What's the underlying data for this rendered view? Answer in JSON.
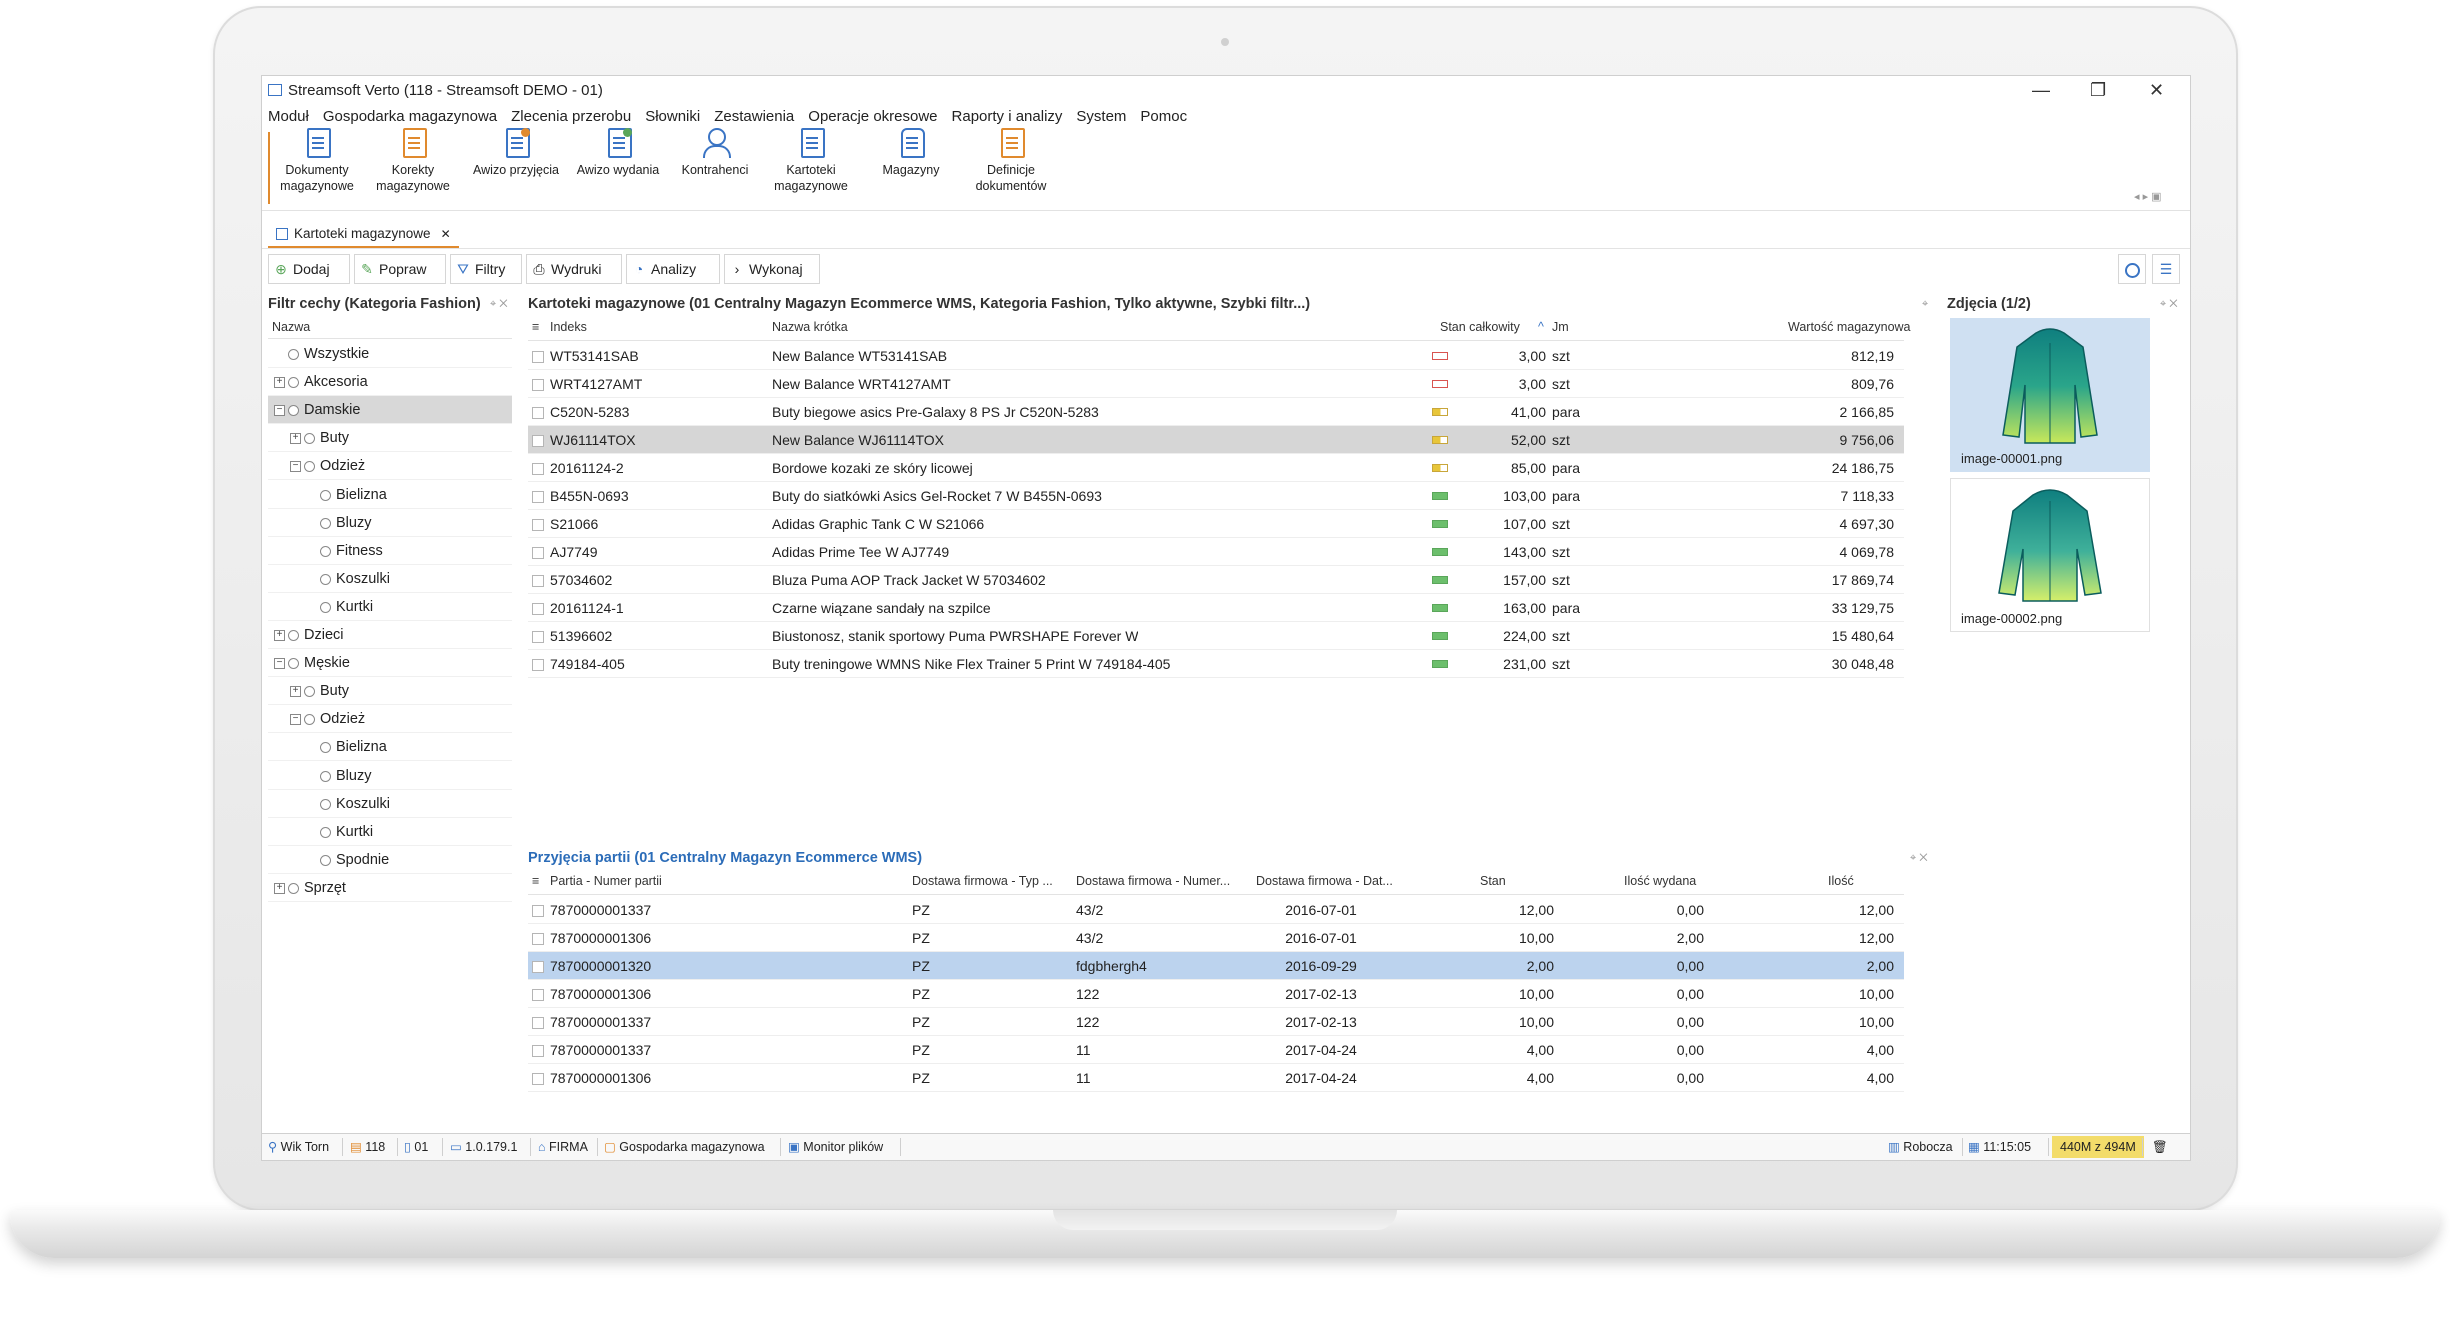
{
  "window": {
    "title": "Streamsoft Verto (118 - Streamsoft DEMO - 01)",
    "controls": [
      "—",
      "❐",
      "✕"
    ]
  },
  "menu": [
    "Moduł",
    "Gospodarka magazynowa",
    "Zlecenia przerobu",
    "Słowniki",
    "Zestawienia",
    "Operacje okresowe",
    "Raporty i analizy",
    "System",
    "Pomoc"
  ],
  "ribbon": [
    {
      "line1": "Dokumenty",
      "line2": "magazynowe"
    },
    {
      "line1": "Korekty",
      "line2": "magazynowe"
    },
    {
      "line1": "Awizo przyjęcia",
      "line2": ""
    },
    {
      "line1": "Awizo wydania",
      "line2": ""
    },
    {
      "line1": "Kontrahenci",
      "line2": ""
    },
    {
      "line1": "Kartoteki",
      "line2": "magazynowe"
    },
    {
      "line1": "Magazyny",
      "line2": ""
    },
    {
      "line1": "Definicje",
      "line2": "dokumentów"
    }
  ],
  "tab": {
    "label": "Kartoteki magazynowe",
    "close": "✕"
  },
  "toolbar": [
    {
      "icon": "⊕",
      "label": "Dodaj"
    },
    {
      "icon": "✎",
      "label": "Popraw"
    },
    {
      "icon": "⛛",
      "label": "Filtry"
    },
    {
      "icon": "⎙",
      "label": "Wydruki"
    },
    {
      "icon": "◔",
      "label": "Analizy"
    },
    {
      "icon": "›",
      "label": "Wykonaj"
    }
  ],
  "filter_panel": {
    "title": "Filtr cechy (Kategoria Fashion)",
    "column": "Nazwa",
    "items": [
      {
        "label": "Wszystkie",
        "level": 0,
        "expander": ""
      },
      {
        "label": "Akcesoria",
        "level": 0,
        "expander": "+"
      },
      {
        "label": "Damskie",
        "level": 0,
        "expander": "−",
        "selected": true
      },
      {
        "label": "Buty",
        "level": 1,
        "expander": "+"
      },
      {
        "label": "Odzież",
        "level": 1,
        "expander": "−"
      },
      {
        "label": "Bielizna",
        "level": 2,
        "expander": ""
      },
      {
        "label": "Bluzy",
        "level": 2,
        "expander": ""
      },
      {
        "label": "Fitness",
        "level": 2,
        "expander": ""
      },
      {
        "label": "Koszulki",
        "level": 2,
        "expander": ""
      },
      {
        "label": "Kurtki",
        "level": 2,
        "expander": ""
      },
      {
        "label": "Dzieci",
        "level": 0,
        "expander": "+"
      },
      {
        "label": "Męskie",
        "level": 0,
        "expander": "−"
      },
      {
        "label": "Buty",
        "level": 1,
        "expander": "+"
      },
      {
        "label": "Odzież",
        "level": 1,
        "expander": "−"
      },
      {
        "label": "Bielizna",
        "level": 2,
        "expander": ""
      },
      {
        "label": "Bluzy",
        "level": 2,
        "expander": ""
      },
      {
        "label": "Koszulki",
        "level": 2,
        "expander": ""
      },
      {
        "label": "Kurtki",
        "level": 2,
        "expander": ""
      },
      {
        "label": "Spodnie",
        "level": 2,
        "expander": ""
      },
      {
        "label": "Sprzęt",
        "level": 0,
        "expander": "+"
      }
    ]
  },
  "items_panel": {
    "title": "Kartoteki magazynowe (01 Centralny Magazyn Ecommerce WMS, Kategoria Fashion, Tylko aktywne, Szybki filtr...)",
    "columns": {
      "index": "Indeks",
      "name": "Nazwa krótka",
      "stock": "Stan całkowity",
      "sort": "^",
      "unit": "Jm",
      "value": "Wartość magazynowa"
    },
    "rows": [
      {
        "index": "WT53141SAB",
        "name": "New Balance WT53141SAB",
        "level": "red",
        "stock": "3,00",
        "unit": "szt",
        "value": "812,19"
      },
      {
        "index": "WRT4127AMT",
        "name": "New Balance WRT4127AMT",
        "level": "red",
        "stock": "3,00",
        "unit": "szt",
        "value": "809,76"
      },
      {
        "index": "C520N-5283",
        "name": "Buty biegowe asics Pre-Galaxy 8 PS Jr C520N-5283",
        "level": "yellow",
        "stock": "41,00",
        "unit": "para",
        "value": "2 166,85"
      },
      {
        "index": "WJ61114TOX",
        "name": "New Balance WJ61114TOX",
        "level": "yellow",
        "stock": "52,00",
        "unit": "szt",
        "value": "9 756,06",
        "selected": true
      },
      {
        "index": "20161124-2",
        "name": "Bordowe kozaki ze skóry licowej",
        "level": "yellow",
        "stock": "85,00",
        "unit": "para",
        "value": "24 186,75"
      },
      {
        "index": "B455N-0693",
        "name": "Buty do siatkówki Asics Gel-Rocket 7 W B455N-0693",
        "level": "green",
        "stock": "103,00",
        "unit": "para",
        "value": "7 118,33"
      },
      {
        "index": "S21066",
        "name": "Adidas Graphic Tank C W S21066",
        "level": "green",
        "stock": "107,00",
        "unit": "szt",
        "value": "4 697,30"
      },
      {
        "index": "AJ7749",
        "name": "Adidas Prime Tee W AJ7749",
        "level": "green",
        "stock": "143,00",
        "unit": "szt",
        "value": "4 069,78"
      },
      {
        "index": "57034602",
        "name": "Bluza Puma AOP Track Jacket W 57034602",
        "level": "green",
        "stock": "157,00",
        "unit": "szt",
        "value": "17 869,74"
      },
      {
        "index": "20161124-1",
        "name": "Czarne wiązane sandały na szpilce",
        "level": "green",
        "stock": "163,00",
        "unit": "para",
        "value": "33 129,75"
      },
      {
        "index": "51396602",
        "name": "Biustonosz, stanik sportowy Puma PWRSHAPE Forever W",
        "level": "green",
        "stock": "224,00",
        "unit": "szt",
        "value": "15 480,64"
      },
      {
        "index": "749184-405",
        "name": "Buty treningowe WMNS Nike Flex Trainer 5 Print W 749184-405",
        "level": "green",
        "stock": "231,00",
        "unit": "szt",
        "value": "30 048,48"
      }
    ]
  },
  "photos_panel": {
    "title": "Zdjęcia (1/2)",
    "items": [
      {
        "caption": "image-00001.png",
        "selected": true
      },
      {
        "caption": "image-00002.png",
        "selected": false
      }
    ]
  },
  "batch_panel": {
    "title": "Przyjęcia partii (01 Centralny Magazyn Ecommerce WMS)",
    "columns": {
      "batch": "Partia - Numer partii",
      "type": "Dostawa firmowa - Typ ...",
      "number": "Dostawa firmowa - Numer...",
      "date": "Dostawa firmowa - Dat...",
      "stock": "Stan",
      "issued": "Ilość wydana",
      "qty": "Ilość"
    },
    "rows": [
      {
        "batch": "7870000001337",
        "type": "PZ",
        "number": "43/2",
        "date": "2016-07-01",
        "stock": "12,00",
        "issued": "0,00",
        "qty": "12,00"
      },
      {
        "batch": "7870000001306",
        "type": "PZ",
        "number": "43/2",
        "date": "2016-07-01",
        "stock": "10,00",
        "issued": "2,00",
        "qty": "12,00"
      },
      {
        "batch": "7870000001320",
        "type": "PZ",
        "number": "fdgbhergh4",
        "date": "2016-09-29",
        "stock": "2,00",
        "issued": "0,00",
        "qty": "2,00",
        "selected": true
      },
      {
        "batch": "7870000001306",
        "type": "PZ",
        "number": "122",
        "date": "2017-02-13",
        "stock": "10,00",
        "issued": "0,00",
        "qty": "10,00"
      },
      {
        "batch": "7870000001337",
        "type": "PZ",
        "number": "122",
        "date": "2017-02-13",
        "stock": "10,00",
        "issued": "0,00",
        "qty": "10,00"
      },
      {
        "batch": "7870000001337",
        "type": "PZ",
        "number": "11",
        "date": "2017-04-24",
        "stock": "4,00",
        "issued": "0,00",
        "qty": "4,00"
      },
      {
        "batch": "7870000001306",
        "type": "PZ",
        "number": "11",
        "date": "2017-04-24",
        "stock": "4,00",
        "issued": "0,00",
        "qty": "4,00"
      }
    ]
  },
  "status": {
    "user": "Wik Torn",
    "db": "118",
    "unit": "01",
    "version": "1.0.179.1",
    "company": "FIRMA",
    "module": "Gospodarka magazynowa",
    "monitor": "Monitor plików",
    "workspace": "Robocza",
    "time": "11:15:05",
    "memory": "440M z 494M"
  },
  "colors": {
    "accent": "#e08a2e",
    "brand_blue": "#3a74c4",
    "panel_title_blue": "#2b6cb8",
    "selection": "#bcd3ee",
    "memory_bg": "#f3dc6a"
  }
}
